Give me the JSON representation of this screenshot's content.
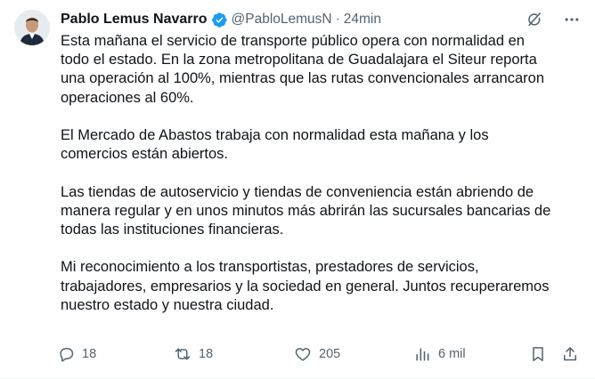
{
  "author": {
    "name": "Pablo Lemus Navarro",
    "handle": "@PabloLemusN",
    "separator": "·",
    "time": "24min",
    "verified": true
  },
  "tweet": {
    "paragraphs": [
      "Esta mañana el servicio de transporte público opera con normalidad en\ntodo el estado. En la zona metropolitana de Guadalajara el Siteur reporta\nuna operación al 100%, mientras que las rutas convencionales arrancaron\noperaciones al 60%.",
      "El Mercado de Abastos trabaja con normalidad esta mañana y los\ncomercios están abiertos.",
      "Las tiendas de autoservicio y tiendas de conveniencia están abriendo de\nmanera regular y en unos minutos más abrirán las sucursales bancarias de\ntodas las instituciones financieras.",
      "Mi reconocimiento a los transportistas, prestadores de servicios,\ntrabajadores, empresarios y la sociedad en general. Juntos recuperaremos\nnuestro estado y nuestra ciudad."
    ]
  },
  "actions": {
    "replies": "18",
    "reposts": "18",
    "likes": "205",
    "views": "6 mil"
  },
  "icons": {
    "verified": "verified-badge-icon",
    "grok": "grok-icon",
    "more": "more-icon",
    "reply": "reply-icon",
    "repost": "repost-icon",
    "like": "heart-icon",
    "views": "views-icon",
    "bookmark": "bookmark-icon",
    "share": "share-icon"
  },
  "colors": {
    "text": "#0f1419",
    "secondary": "#536471",
    "verified": "#1d9bf0"
  }
}
